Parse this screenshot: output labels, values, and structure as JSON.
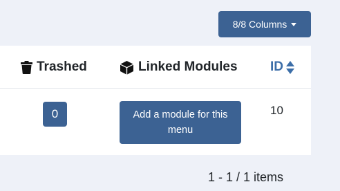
{
  "toolbar": {
    "columns_label": "8/8 Columns"
  },
  "table": {
    "headers": {
      "trashed": "Trashed",
      "linked_modules": "Linked Modules",
      "id": "ID"
    },
    "rows": [
      {
        "trashed": "0",
        "linked_modules_button": "Add a module for this menu",
        "id": "10"
      }
    ]
  },
  "footer": {
    "pagination": "1 - 1 / 1 items"
  },
  "colors": {
    "accent": "#3c6293",
    "link": "#3c6ea8",
    "background": "#eef1f8"
  }
}
